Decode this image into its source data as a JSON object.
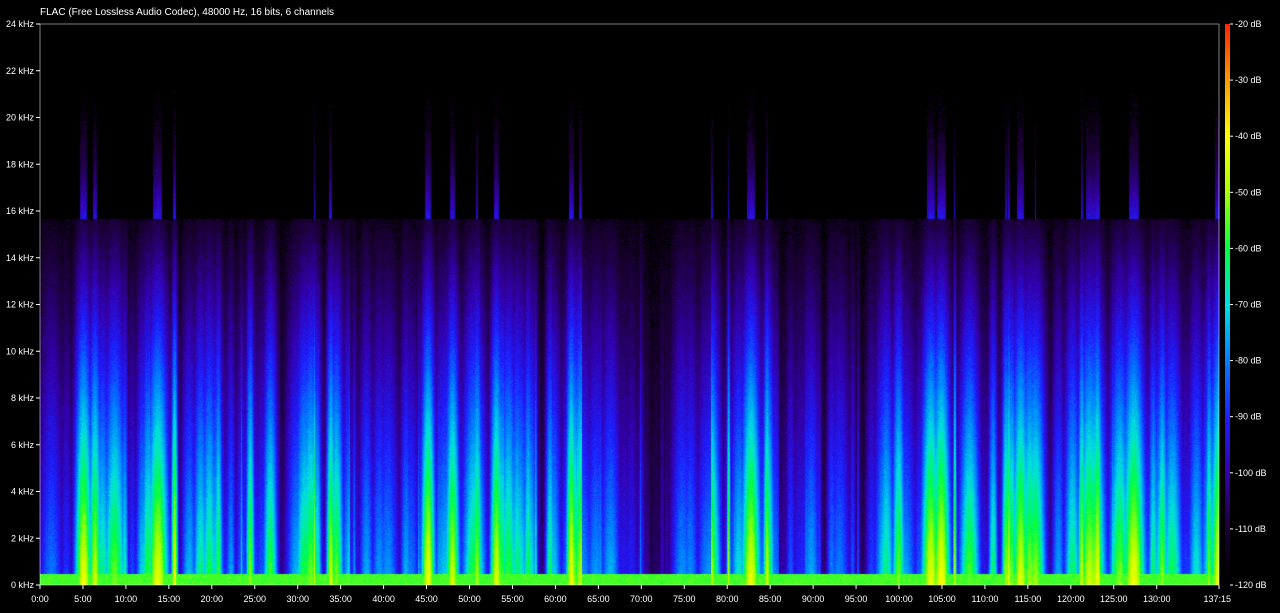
{
  "chart_data": {
    "type": "heatmap",
    "title": "FLAC (Free Lossless Audio Codec), 48000 Hz, 16 bits, 6 channels",
    "xlabel": "",
    "ylabel": "",
    "x_tick_labels": [
      "0:00",
      "5:00",
      "10:00",
      "15:00",
      "20:00",
      "25:00",
      "30:00",
      "35:00",
      "40:00",
      "45:00",
      "50:00",
      "55:00",
      "60:00",
      "65:00",
      "70:00",
      "75:00",
      "80:00",
      "85:00",
      "90:00",
      "95:00",
      "100:00",
      "105:00",
      "110:00",
      "115:00",
      "120:00",
      "125:00",
      "130:00",
      "137:15"
    ],
    "x_tick_minutes": [
      0,
      5,
      10,
      15,
      20,
      25,
      30,
      35,
      40,
      45,
      50,
      55,
      60,
      65,
      70,
      75,
      80,
      85,
      90,
      95,
      100,
      105,
      110,
      115,
      120,
      125,
      130,
      137.25
    ],
    "xlim_minutes": [
      0,
      137.25
    ],
    "y_tick_labels": [
      "0 kHz",
      "2 kHz",
      "4 kHz",
      "6 kHz",
      "8 kHz",
      "10 kHz",
      "12 kHz",
      "14 kHz",
      "16 kHz",
      "18 kHz",
      "20 kHz",
      "22 kHz",
      "24 kHz"
    ],
    "y_tick_khz": [
      0,
      2,
      4,
      6,
      8,
      10,
      12,
      14,
      16,
      18,
      20,
      22,
      24
    ],
    "ylim_khz": [
      0,
      24
    ],
    "colorbar": {
      "tick_labels": [
        "-20 dB",
        "-30 dB",
        "-40 dB",
        "-50 dB",
        "-60 dB",
        "-70 dB",
        "-80 dB",
        "-90 dB",
        "-100 dB",
        "-110 dB",
        "-120 dB"
      ],
      "tick_db": [
        -20,
        -30,
        -40,
        -50,
        -60,
        -70,
        -80,
        -90,
        -100,
        -110,
        -120
      ],
      "range_db": [
        -120,
        -20
      ],
      "colors": [
        "#000000",
        "#1a0033",
        "#3300aa",
        "#1e1eff",
        "#0080ff",
        "#00e0e0",
        "#00ff40",
        "#aaff00",
        "#ffff00",
        "#ff9900",
        "#ff2000"
      ]
    },
    "lowpass_cutoff_khz": 15.7,
    "grid": false
  }
}
